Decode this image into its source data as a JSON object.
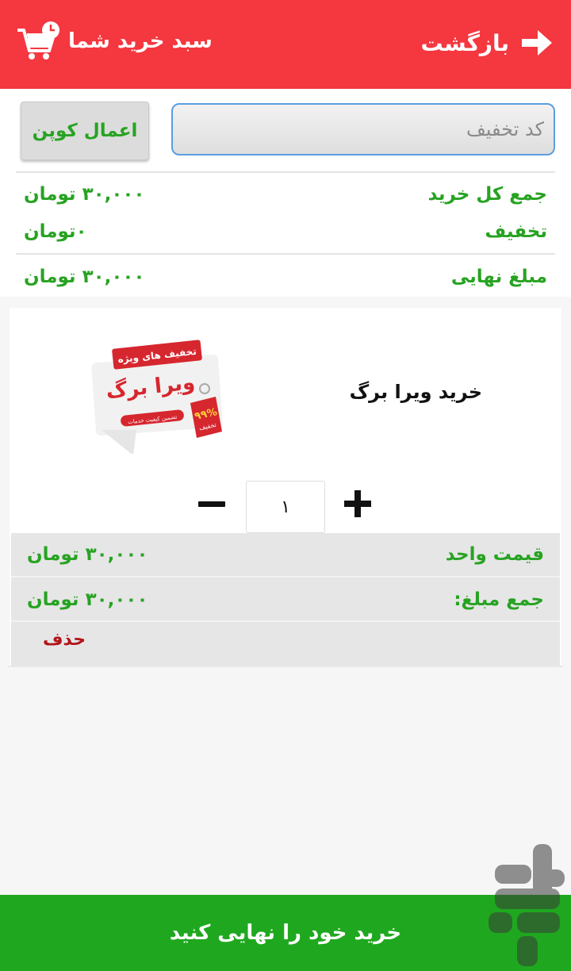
{
  "header": {
    "back_label": "بازگشت",
    "cart_title": "سبد خرید شما"
  },
  "coupon": {
    "placeholder": "کد تخفیف",
    "apply_label": "اعمال کوپن"
  },
  "summary": {
    "total_label": "جمع کل خرید",
    "total_value": "۳۰,۰۰۰ تومان",
    "discount_label": "تخفیف",
    "discount_value": "۰تومان",
    "final_label": "مبلغ نهایی",
    "final_value": "۳۰,۰۰۰ تومان"
  },
  "item": {
    "name": "خرید ویرا برگ",
    "image_text": {
      "banner": "تخفیف های ویژه",
      "brand": "ویرا برگ",
      "tagline": "تضمین کیفیت خدمات",
      "badge": "۹۹%",
      "badge_sub": "تخفیف"
    },
    "quantity": "۱",
    "unit_price_label": "قیمت واحد",
    "unit_price_value": "۳۰,۰۰۰ تومان",
    "line_total_label": "جمع مبلغ:",
    "line_total_value": "۳۰,۰۰۰ تومان",
    "delete_label": "حذف"
  },
  "checkout_label": "خرید خود را نهایی کنید",
  "colors": {
    "header": "#f5373f",
    "accent_green": "#27a322",
    "checkout_bar": "#1fa81f",
    "delete_red": "#b3141a"
  },
  "icons": [
    "back-arrow-icon",
    "cart-icon",
    "minus-icon",
    "plus-icon"
  ]
}
